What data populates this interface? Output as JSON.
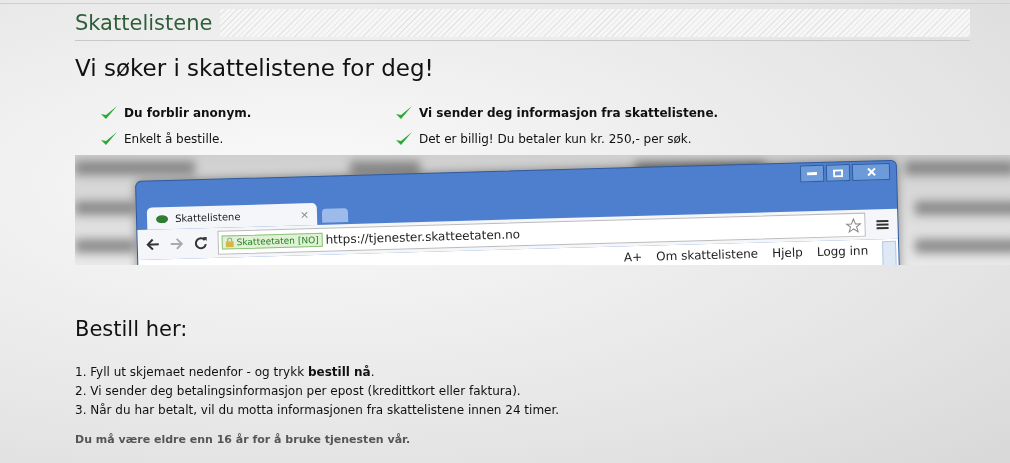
{
  "header": {
    "title": "Skattelistene"
  },
  "heading": "Vi søker i skattelistene for deg!",
  "features": [
    {
      "text": "Du forblir anonym.",
      "emphasis": true
    },
    {
      "text": "Vi sender deg informasjon fra skattelistene.",
      "emphasis": true
    },
    {
      "text": "Enkelt å bestille.",
      "emphasis": false
    },
    {
      "text": "Det er billig! Du betaler kun kr. 250,- per søk.",
      "emphasis": false
    }
  ],
  "banner": {
    "tab_title": "Skattelistene",
    "tab_close": "×",
    "site_badge": "Skatteetaten [NO]",
    "url": "https://tjenester.skatteetaten.no",
    "page_links": [
      "A+",
      "Om skattelistene",
      "Hjelp",
      "Logg inn"
    ]
  },
  "order": {
    "heading": "Bestill her:",
    "steps": [
      "1. Fyll ut skjemaet nedenfor - og trykk **bestill nå**.",
      "2. Vi sender deg betalingsinformasjon per epost (kredittkort eller faktura).",
      "3. Når du har betalt, vil du motta informasjonen fra skattelistene innen 24 timer."
    ],
    "note": "Du må være eldre enn 16 år for å bruke tjenesten vår."
  }
}
